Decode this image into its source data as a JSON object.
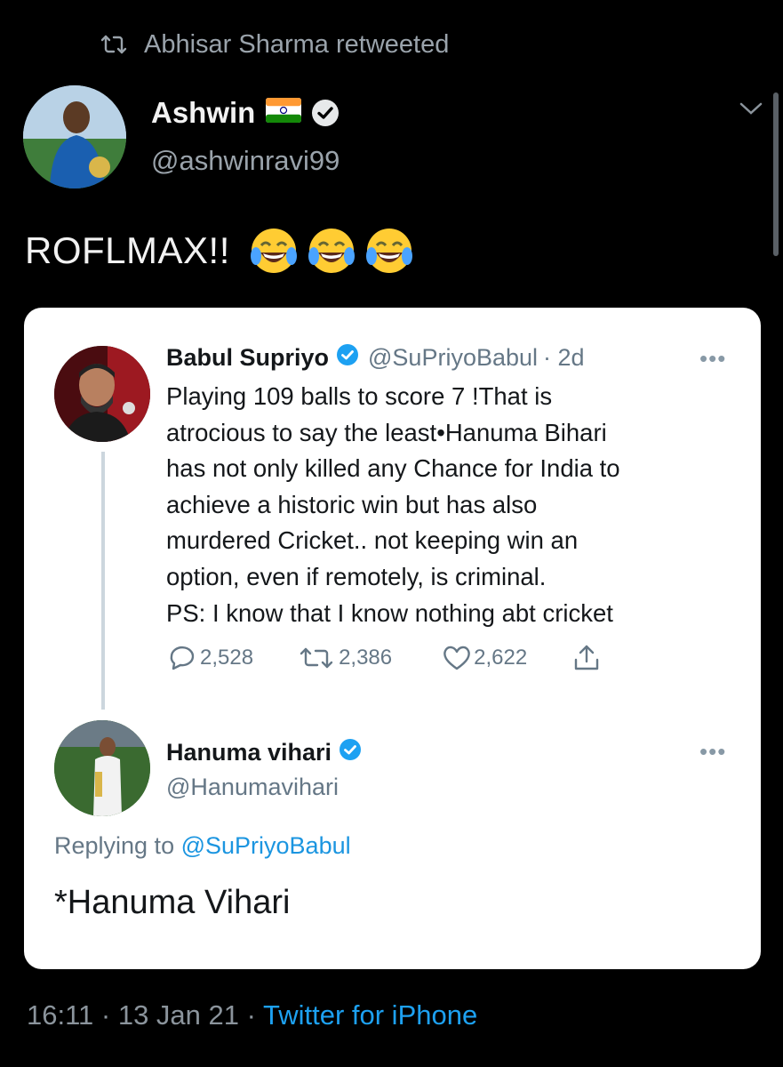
{
  "retweet": {
    "label": "Abhisar Sharma retweeted"
  },
  "author": {
    "name": "Ashwin",
    "flag": "🇮🇳",
    "handle": "@ashwinravi99"
  },
  "tweet": {
    "text": "ROFLMAX!!",
    "emoji": [
      "face-with-tears-of-joy",
      "face-with-tears-of-joy",
      "face-with-tears-of-joy"
    ]
  },
  "quoted_tweet": {
    "author": {
      "name": "Babul Supriyo",
      "handle": "@SuPriyoBabul",
      "time": "· 2d"
    },
    "lines": [
      "Playing 109 balls to score 7 !That is",
      "atrocious to say the least•Hanuma Bihari",
      "has not only killed any Chance for India to",
      "achieve a historic win but has also",
      "murdered Cricket.. not keeping win an",
      "option, even if remotely, is criminal.",
      "PS: I know that I know nothing abt cricket"
    ],
    "stats": {
      "replies": "2,528",
      "retweets": "2,386",
      "likes": "2,622"
    }
  },
  "reply": {
    "author": {
      "name": "Hanuma vihari",
      "handle": "@Hanumavihari"
    },
    "replying_prefix": "Replying to ",
    "replying_to": "@SuPriyoBabul",
    "text": "*Hanuma Vihari"
  },
  "footer": {
    "time": "16:11 · 13 Jan 21 · ",
    "source": "Twitter for iPhone"
  },
  "colors": {
    "background": "#000000",
    "link": "#1da1f2",
    "verified": "#1da1f2",
    "card": "#ffffff"
  }
}
